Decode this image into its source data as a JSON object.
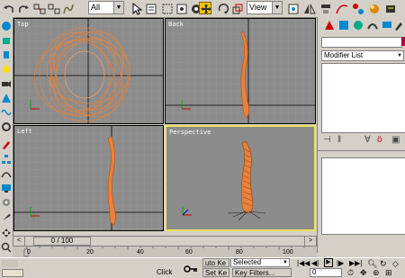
{
  "toolbar": {
    "selection_filter": "All",
    "reference_coord": "View"
  },
  "viewports": {
    "top": "Top",
    "back": "Back",
    "left": "Left",
    "perspective": "Perspective"
  },
  "command_panel": {
    "modifier_list": "Modifier List"
  },
  "time_slider": {
    "frame_readout": "0 / 100",
    "ticks": [
      "0",
      "20",
      "40",
      "60",
      "80",
      "100"
    ]
  },
  "status": {
    "prompt": "Click",
    "auto_key": "uto Ke",
    "set_key": "Set Ke",
    "selection_set": "Selected",
    "key_filters": "Key Filters...",
    "frame_field": "0"
  },
  "colors": {
    "accent_active": "#f5c400",
    "viewport_bg": "#8c8c8c",
    "object_orange": "#e8823c",
    "viewport_active_border": "#f0e060",
    "swatch": "#b00040"
  }
}
